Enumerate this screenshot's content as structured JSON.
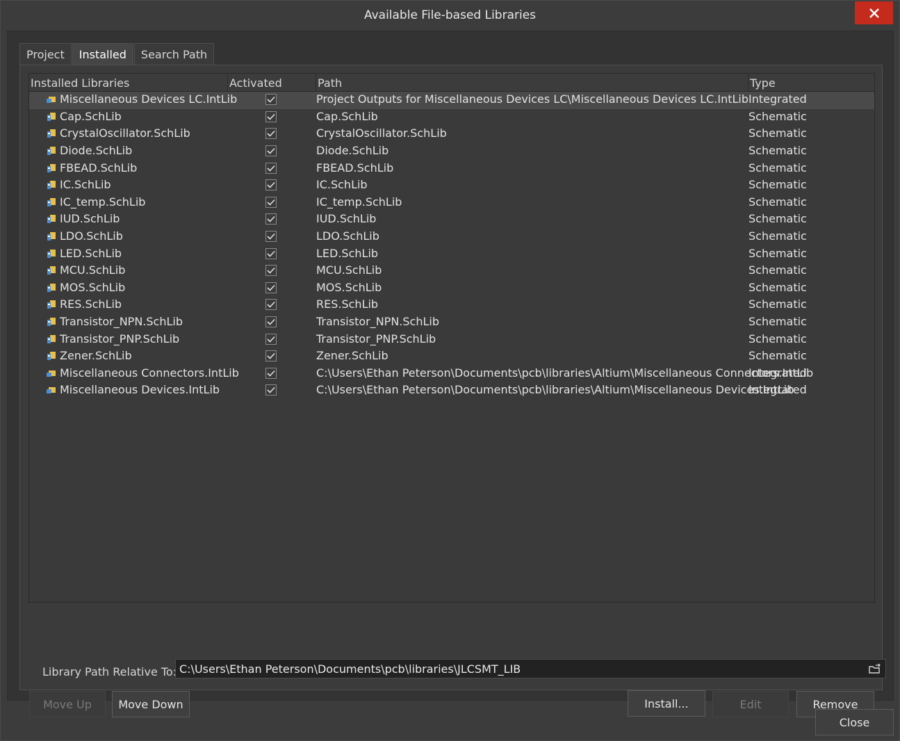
{
  "window": {
    "title": "Available File-based Libraries"
  },
  "tabs": [
    {
      "label": "Project"
    },
    {
      "label": "Installed"
    },
    {
      "label": "Search Path"
    }
  ],
  "grid": {
    "headers": {
      "name": "Installed Libraries",
      "activated": "Activated",
      "path": "Path",
      "type": "Type"
    },
    "rows": [
      {
        "name": "Miscellaneous Devices LC.IntLib",
        "activated": true,
        "path": "Project Outputs for Miscellaneous Devices LC\\Miscellaneous Devices LC.IntLib",
        "type": "Integrated"
      },
      {
        "name": "Cap.SchLib",
        "activated": true,
        "path": "Cap.SchLib",
        "type": "Schematic"
      },
      {
        "name": "CrystalOscillator.SchLib",
        "activated": true,
        "path": "CrystalOscillator.SchLib",
        "type": "Schematic"
      },
      {
        "name": "Diode.SchLib",
        "activated": true,
        "path": "Diode.SchLib",
        "type": "Schematic"
      },
      {
        "name": "FBEAD.SchLib",
        "activated": true,
        "path": "FBEAD.SchLib",
        "type": "Schematic"
      },
      {
        "name": "IC.SchLib",
        "activated": true,
        "path": "IC.SchLib",
        "type": "Schematic"
      },
      {
        "name": "IC_temp.SchLib",
        "activated": true,
        "path": "IC_temp.SchLib",
        "type": "Schematic"
      },
      {
        "name": "IUD.SchLib",
        "activated": true,
        "path": "IUD.SchLib",
        "type": "Schematic"
      },
      {
        "name": "LDO.SchLib",
        "activated": true,
        "path": "LDO.SchLib",
        "type": "Schematic"
      },
      {
        "name": "LED.SchLib",
        "activated": true,
        "path": "LED.SchLib",
        "type": "Schematic"
      },
      {
        "name": "MCU.SchLib",
        "activated": true,
        "path": "MCU.SchLib",
        "type": "Schematic"
      },
      {
        "name": "MOS.SchLib",
        "activated": true,
        "path": "MOS.SchLib",
        "type": "Schematic"
      },
      {
        "name": "RES.SchLib",
        "activated": true,
        "path": "RES.SchLib",
        "type": "Schematic"
      },
      {
        "name": "Transistor_NPN.SchLib",
        "activated": true,
        "path": "Transistor_NPN.SchLib",
        "type": "Schematic"
      },
      {
        "name": "Transistor_PNP.SchLib",
        "activated": true,
        "path": "Transistor_PNP.SchLib",
        "type": "Schematic"
      },
      {
        "name": "Zener.SchLib",
        "activated": true,
        "path": "Zener.SchLib",
        "type": "Schematic"
      },
      {
        "name": "Miscellaneous Connectors.IntLib",
        "activated": true,
        "path": "C:\\Users\\Ethan Peterson\\Documents\\pcb\\libraries\\Altium\\Miscellaneous Connectors.IntLib",
        "type": "Integrated"
      },
      {
        "name": "Miscellaneous Devices.IntLib",
        "activated": true,
        "path": "C:\\Users\\Ethan Peterson\\Documents\\pcb\\libraries\\Altium\\Miscellaneous Devices.IntLib",
        "type": "Integrated"
      }
    ],
    "selected_row": 0
  },
  "library_path": {
    "label": "Library Path Relative To:",
    "value": "C:\\Users\\Ethan Peterson\\Documents\\pcb\\libraries\\JLCSMT_LIB",
    "browse_icon": "folder-open-icon"
  },
  "buttons": {
    "move_up": "Move Up",
    "move_down": "Move Down",
    "install": "Install...",
    "edit": "Edit",
    "remove": "Remove",
    "close": "Close"
  },
  "colors": {
    "background": "#3c3c3c",
    "close_button": "#c42b1c",
    "selected_row": "#4a4a4a"
  }
}
